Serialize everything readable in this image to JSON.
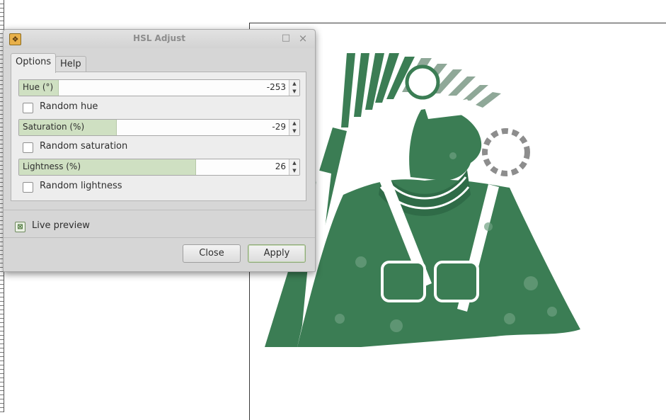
{
  "dialog": {
    "title": "HSL Adjust",
    "app_icon": "gimp-filter-icon",
    "titlebar_buttons": {
      "maximize": "□",
      "close": "×"
    },
    "tabs": [
      {
        "label": "Options",
        "active": true
      },
      {
        "label": "Help",
        "active": false
      }
    ],
    "hue": {
      "label": "Hue (°)",
      "value": "-253",
      "fill_fraction": 0.14
    },
    "random_hue": {
      "label": "Random hue",
      "checked": false
    },
    "saturation": {
      "label": "Saturation (%)",
      "value": "-29",
      "fill_fraction": 0.345
    },
    "random_saturation": {
      "label": "Random saturation",
      "checked": false
    },
    "lightness": {
      "label": "Lightness (%)",
      "value": "26",
      "fill_fraction": 0.63
    },
    "random_lightness": {
      "label": "Random lightness",
      "checked": false
    },
    "live_preview": {
      "label": "Live preview",
      "checked": true,
      "mark": "⊠"
    },
    "buttons": {
      "close": "Close",
      "apply": "Apply"
    }
  },
  "canvas": {
    "image_subject": "green-egyptian-pharaoh-artwork",
    "colors": {
      "art_fill": "#3b7d54",
      "art_light": "#6ea080",
      "background": "#ffffff"
    }
  }
}
